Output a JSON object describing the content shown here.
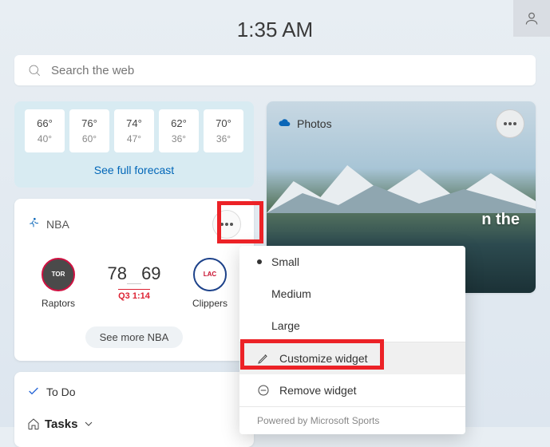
{
  "clock": "1:35 AM",
  "search": {
    "placeholder": "Search the web"
  },
  "weather": {
    "days": [
      {
        "hi": "66°",
        "lo": "40°"
      },
      {
        "hi": "76°",
        "lo": "60°"
      },
      {
        "hi": "74°",
        "lo": "47°"
      },
      {
        "hi": "62°",
        "lo": "36°"
      },
      {
        "hi": "70°",
        "lo": "36°"
      }
    ],
    "forecast_link": "See full forecast"
  },
  "nba": {
    "title": "NBA",
    "team_a": {
      "name": "Raptors",
      "score": "78"
    },
    "team_b": {
      "name": "Clippers",
      "score": "69"
    },
    "status": "Q3 1:14",
    "more": "See more NBA"
  },
  "todo": {
    "title": "To Do",
    "tasks_label": "Tasks"
  },
  "photos": {
    "title": "Photos",
    "caption_fragment": "n the"
  },
  "context_menu": {
    "small": "Small",
    "medium": "Medium",
    "large": "Large",
    "customize": "Customize widget",
    "remove": "Remove widget",
    "footer": "Powered by Microsoft Sports"
  }
}
